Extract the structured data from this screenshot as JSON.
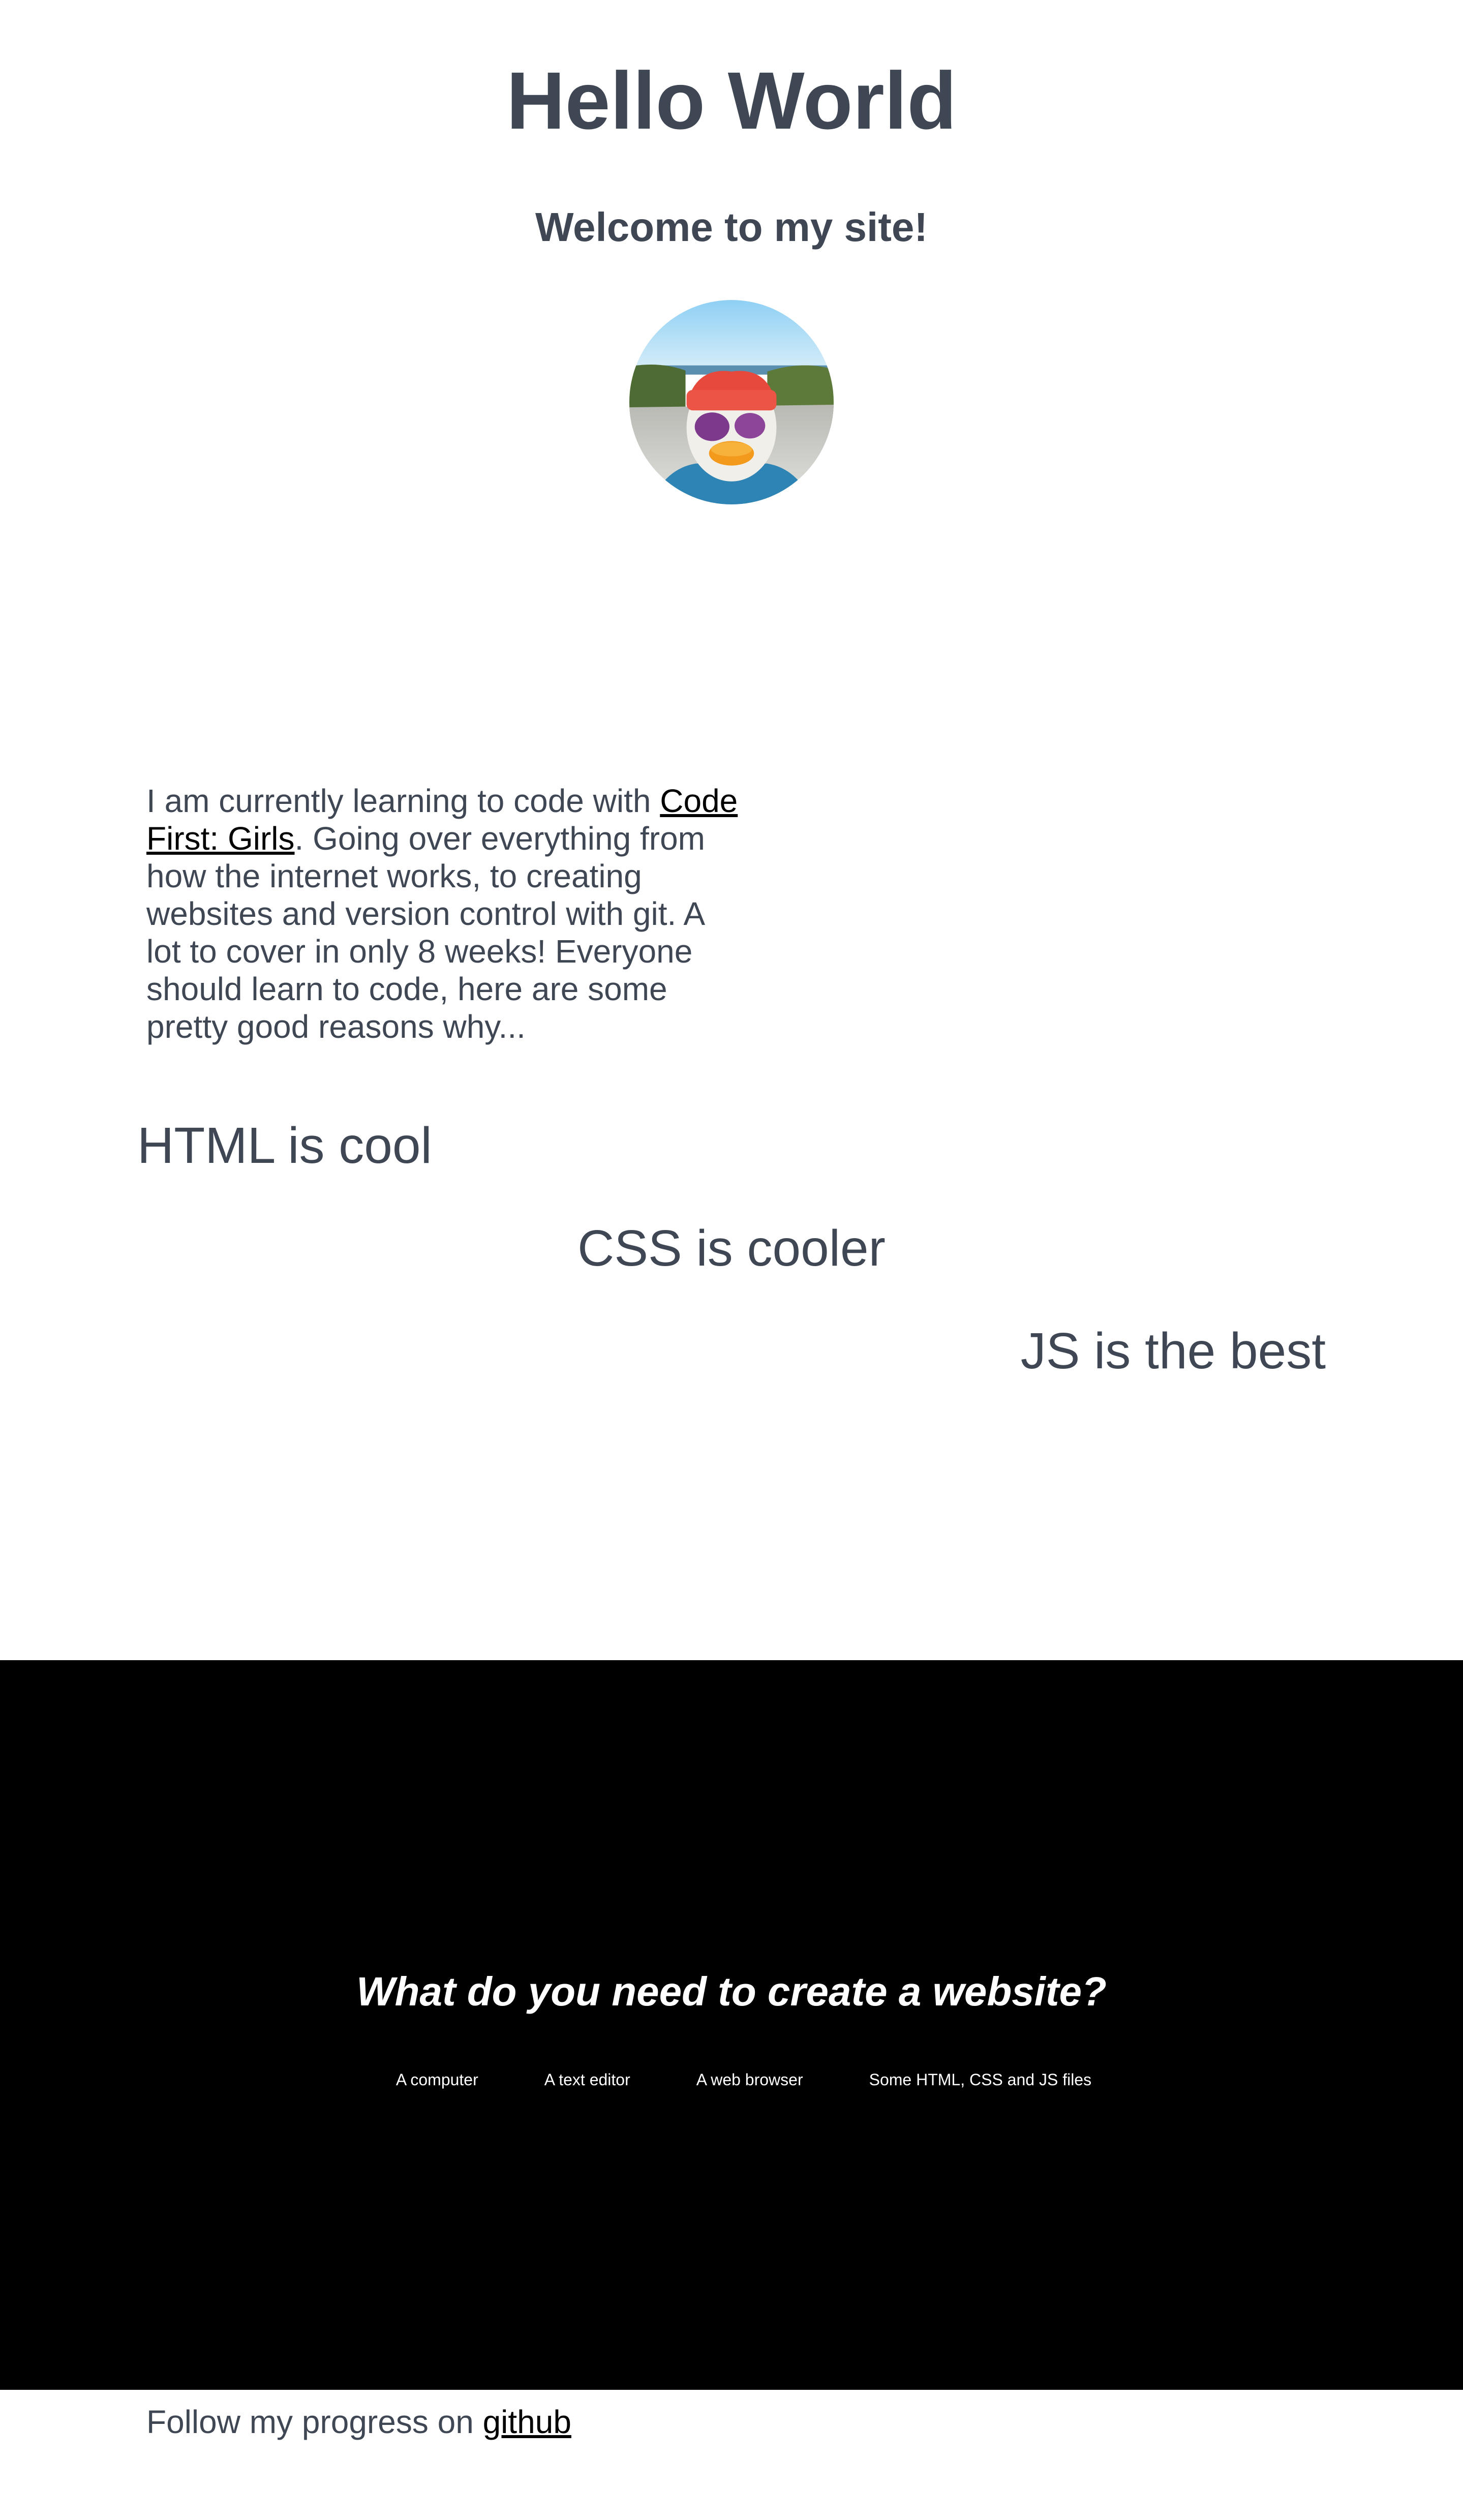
{
  "header": {
    "title": "Hello World",
    "subtitle": "Welcome to my site!"
  },
  "avatar": {
    "icon": "rubber-duck-photo"
  },
  "intro": {
    "before_link": "I am currently learning to code with ",
    "link_text": "Code First: Girls",
    "after_link": ". Going over everything from how the internet works, to creating websites and version control with git. A lot to cover in only 8 weeks! Everyone should learn to code, here are some pretty good reasons why..."
  },
  "languages": {
    "html": "HTML is cool",
    "css": "CSS is cooler",
    "js": "JS is the best"
  },
  "requirements": {
    "title": "What do you need to create a website?",
    "items": [
      "A computer",
      "A text editor",
      "A web browser",
      "Some HTML, CSS and JS files"
    ]
  },
  "footer": {
    "text": "Follow my progress on ",
    "link_text": "github"
  },
  "colors": {
    "text": "#3f4754",
    "link": "#000000",
    "section_bg": "#000000",
    "section_text": "#ffffff"
  }
}
